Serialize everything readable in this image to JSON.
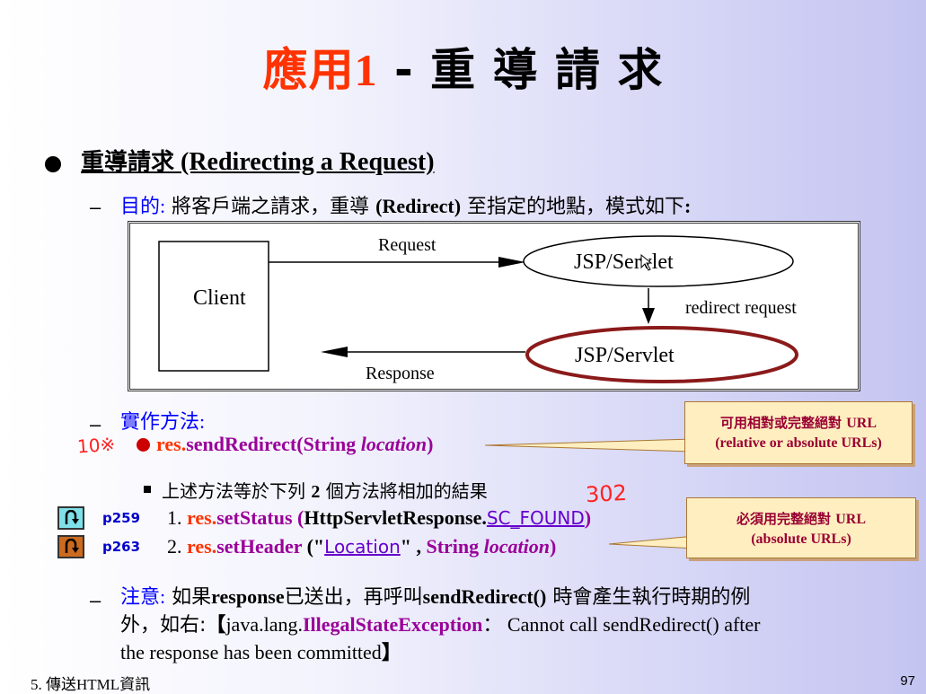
{
  "slide": {
    "title": {
      "part1": "應用",
      "part2": "1",
      "part3": " - 重 導 請 求"
    },
    "bullet1": {
      "cjk": "重導請求",
      "en": " (Redirecting a Request)"
    },
    "purpose": {
      "label": "目的",
      "colon": ":",
      "t1": " 將客戶端之請求，重導 ",
      "t2": "(Redirect)",
      "t3": " 至指定的地點，模式如下",
      "t4": ":"
    },
    "diagram": {
      "client": "Client",
      "request": "Request",
      "response": "Response",
      "server_top": "JSP/Servlet",
      "server_bottom": "JSP/Servlet",
      "redirect": "redirect request"
    },
    "impl": {
      "label": "實作方法",
      "colon": ":"
    },
    "handwriting": {
      "note1": "10※",
      "note2": "302"
    },
    "method": {
      "prefix": "res.",
      "name": "sendRedirect",
      "open": "(",
      "type": "String ",
      "param": "location",
      "close": ")"
    },
    "sub": {
      "t1": "上述方法等於下列 ",
      "num": "2",
      "t2": " 個方法將相加的結果"
    },
    "step1": {
      "ref": "p259",
      "num": "1. ",
      "prefix": "res.",
      "name": "setStatus",
      "open": " (",
      "cls": "HttpServletResponse.",
      "const": "SC_FOUND",
      "close": ")"
    },
    "step2": {
      "ref": "p263",
      "num": "2. ",
      "prefix": "res.",
      "name": "setHeader",
      "open": " (\"",
      "key": "Location",
      "mid": "\" , ",
      "type": "String ",
      "param": "location",
      "close": ")"
    },
    "callout1": {
      "line1a": "可用相對或完整絕對 ",
      "line1b": "URL",
      "line2": "(relative or absolute URLs)"
    },
    "callout2": {
      "line1a": "必須用完整絕對 ",
      "line1b": "URL",
      "line2": "(absolute URLs)"
    },
    "note": {
      "label": "注意",
      "colon": ":",
      "t1": " 如果",
      "b1": "response",
      "t2": "已送出，再呼叫",
      "b2": "sendRedirect()",
      "t3": " 時會產生執行時期的例",
      "t4": "外，如右:",
      "br1": "【",
      "t5": "java.lang.",
      "exc": "IllegalStateException",
      "t6": "： Cannot call sendRedirect() after",
      "t7": "the response has been committed",
      "br2": "】"
    },
    "footer": {
      "left": "5. 傳送HTML資訊",
      "page": "97"
    }
  }
}
